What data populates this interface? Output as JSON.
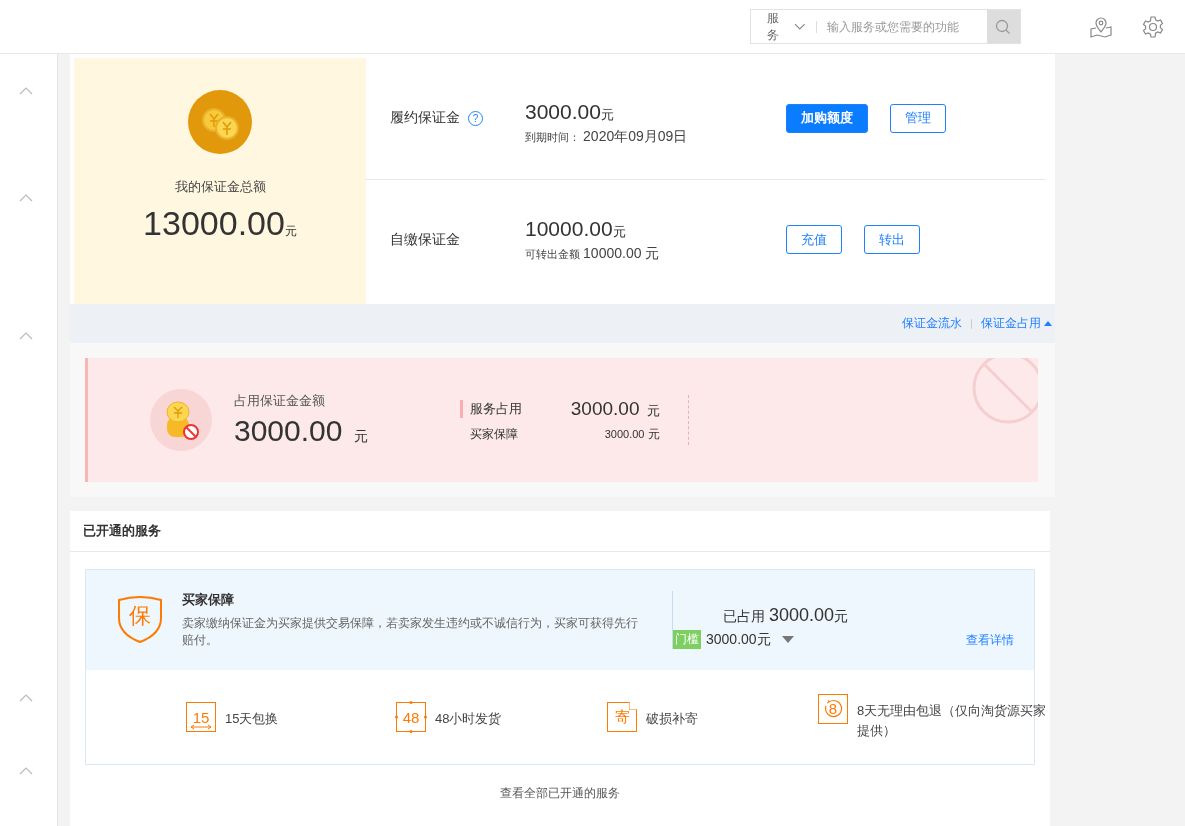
{
  "topbar": {
    "search": {
      "scope": "服务",
      "placeholder": "输入服务或您需要的功能"
    }
  },
  "summary": {
    "title": "我的保证金总额",
    "amount": "13000.00",
    "unit": "元"
  },
  "deposits": [
    {
      "name": "履约保证金",
      "help_icon": "?",
      "amount": "3000.00",
      "unit": "元",
      "note_label": "到期时间：",
      "note_value": "2020年09月09日",
      "buttons": [
        {
          "label": "加购额度",
          "primary": true
        },
        {
          "label": "管理",
          "primary": false
        }
      ]
    },
    {
      "name": "自缴保证金",
      "amount": "10000.00",
      "unit": "元",
      "note_label": "可转出金额",
      "note_value": "10000.00 元",
      "buttons": [
        {
          "label": "充值",
          "primary": false
        },
        {
          "label": "转出",
          "primary": false
        }
      ]
    }
  ],
  "links": [
    {
      "label": "保证金流水"
    },
    {
      "label": "保证金占用",
      "expanded": true
    }
  ],
  "occupied": {
    "title": "占用保证金金额",
    "amount": "3000.00",
    "unit": "元",
    "breakdown": [
      {
        "kind": "total",
        "label": "服务占用",
        "amount": "3000.00",
        "unit": "元"
      },
      {
        "kind": "item",
        "label": "买家保障",
        "amount": "3000.00",
        "unit": "元"
      }
    ]
  },
  "services": {
    "title": "已开通的服务",
    "items": [
      {
        "badge": "保",
        "name": "买家保障",
        "description": "卖家缴纳保证金为买家提供交易保障，若卖家发生违约或不诚信行为，买家可获得先行赔付。",
        "used_label": "已占用",
        "used_amount": "3000.00",
        "used_unit": "元",
        "tag": "门槛",
        "threshold": "3000.00元",
        "detail_link": "查看详情",
        "features": [
          {
            "kind": "exchange",
            "icon_text": "15",
            "label": "15天包换"
          },
          {
            "kind": "timer",
            "icon_text": "48",
            "label": "48小时发货"
          },
          {
            "kind": "mail",
            "icon_text": "寄",
            "label": "破损补寄"
          },
          {
            "kind": "return",
            "icon_text": "8",
            "label": "8天无理由包退（仅向淘货源买家提供）"
          }
        ]
      }
    ],
    "footer_link": "查看全部已开通的服务"
  }
}
